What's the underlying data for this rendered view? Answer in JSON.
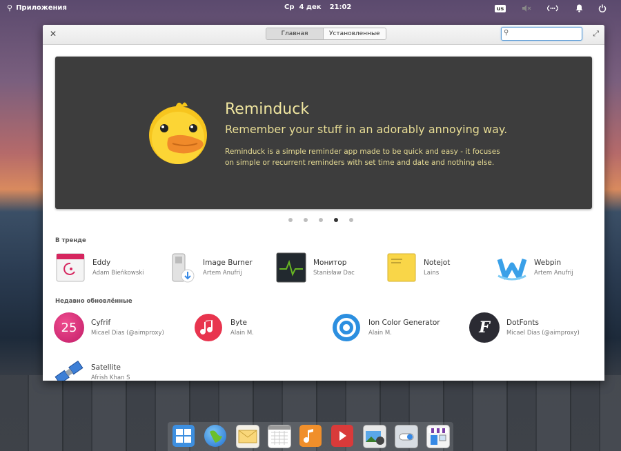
{
  "panel": {
    "applications_label": "Приложения",
    "day": "Ср",
    "date": "4 дек",
    "time": "21:02",
    "keyboard_layout": "us",
    "icons": [
      "search-icon",
      "keyboard-icon",
      "muted-speaker-icon",
      "network-icon",
      "notification-bell-icon",
      "power-icon"
    ]
  },
  "window": {
    "tabs": [
      {
        "label": "Главная",
        "active": true
      },
      {
        "label": "Установленные",
        "active": false
      }
    ],
    "search": {
      "value": "",
      "placeholder": ""
    }
  },
  "banner": {
    "title": "Reminduck",
    "subtitle": "Remember your stuff in an adorably annoying way.",
    "description": "Reminduck is a simple reminder app made to be quick and easy - it focuses on simple or recurrent reminders with set time and date and nothing else.",
    "page_count": 5,
    "active_page": 4,
    "colors": {
      "background": "#3d3d3d",
      "text": "#f0e6a0"
    }
  },
  "trending": {
    "heading": "В тренде",
    "apps": [
      {
        "name": "Eddy",
        "author": "Adam Bieńkowski",
        "icon": "debian-package-icon"
      },
      {
        "name": "Image Burner",
        "author": "Artem Anufrij",
        "icon": "usb-drive-icon"
      },
      {
        "name": "Монитор",
        "author": "Stanisław Dac",
        "icon": "system-monitor-icon"
      },
      {
        "name": "Notejot",
        "author": "Lains",
        "icon": "sticky-note-icon"
      },
      {
        "name": "Webpin",
        "author": "Artem Anufrij",
        "icon": "webpin-w-icon"
      }
    ]
  },
  "recent": {
    "heading": "Недавно обновлённые",
    "apps": [
      {
        "name": "Cyfrif",
        "author": "Micael Dias (@aimproxy)",
        "icon": "calculator-25-icon",
        "icon_text": "25"
      },
      {
        "name": "Byte",
        "author": "Alain M.",
        "icon": "music-note-icon"
      },
      {
        "name": "Ion Color Generator",
        "author": "Alain M.",
        "icon": "color-ring-icon"
      },
      {
        "name": "DotFonts",
        "author": "Micael Dias (@aimproxy)",
        "icon": "font-f-icon",
        "icon_text": "F"
      },
      {
        "name": "Satellite",
        "author": "Afrish Khan S",
        "icon": "satellite-icon"
      }
    ]
  },
  "dock": {
    "items": [
      "multitasking-view-icon",
      "web-browser-icon",
      "mail-icon",
      "calendar-icon",
      "music-icon",
      "videos-icon",
      "photos-icon",
      "settings-icon",
      "appcenter-icon"
    ]
  }
}
